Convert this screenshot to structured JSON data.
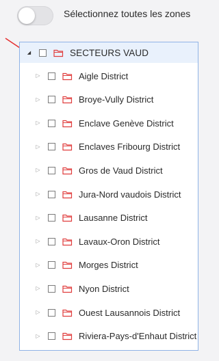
{
  "toggle": {
    "label": "Sélectionnez toutes les zones",
    "checked": false
  },
  "tree": {
    "root": {
      "label": "SECTEURS VAUD",
      "expanded": true,
      "checked": false,
      "icon": "folder-icon"
    },
    "children": [
      {
        "label": "Aigle District"
      },
      {
        "label": "Broye-Vully District"
      },
      {
        "label": "Enclave Genève District"
      },
      {
        "label": "Enclaves Fribourg District"
      },
      {
        "label": "Gros de Vaud District"
      },
      {
        "label": "Jura-Nord vaudois District"
      },
      {
        "label": "Lausanne District"
      },
      {
        "label": "Lavaux-Oron District"
      },
      {
        "label": "Morges District"
      },
      {
        "label": "Nyon District"
      },
      {
        "label": "Ouest Lausannois District"
      },
      {
        "label": "Riviera-Pays-d'Enhaut District"
      }
    ]
  },
  "colors": {
    "accent_border": "#8fb3e6",
    "root_highlight": "#e9f1fc",
    "folder_icon": "#e03c3c",
    "annotation_arrow": "#e53030"
  }
}
